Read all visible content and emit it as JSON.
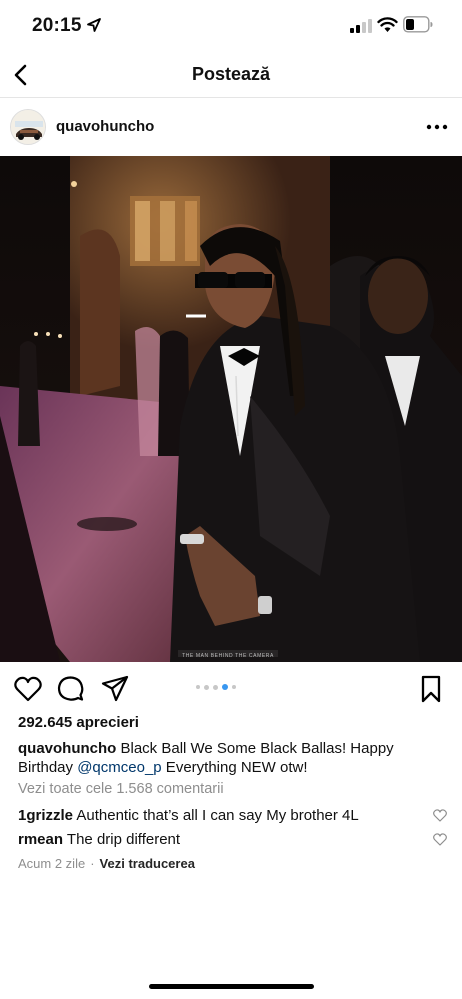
{
  "status_bar": {
    "time": "20:15",
    "icons": [
      "location-arrow-icon",
      "signal-icon",
      "wifi-icon",
      "battery-icon"
    ]
  },
  "nav": {
    "title": "Postează",
    "back_icon": "chevron-left-icon"
  },
  "post": {
    "username": "quavohuncho",
    "more_icon": "more-horizontal-icon",
    "image_watermark": "THE MAN BEHIND THE CAMERA",
    "carousel": {
      "count": 5,
      "active_index": 3
    },
    "likes": "292.645 aprecieri",
    "caption": {
      "user": "quavohuncho",
      "text_before": " Black Ball We Some Black Ballas! Happy Birthday ",
      "mention": "@qcmceo_p",
      "text_after": " Everything NEW otw!"
    },
    "view_comments": "Vezi toate cele 1.568 comentarii",
    "comments": [
      {
        "user": "1grizzle",
        "text": " Authentic that’s all I can say My brother 4L"
      },
      {
        "user": "rmean",
        "text": " The drip different"
      }
    ],
    "time_ago": "Acum 2 zile",
    "separator": "·",
    "translate": "Vezi traducerea"
  },
  "colors": {
    "accent": "#3897f0",
    "muted": "#8e8e8e",
    "mention": "#00376b",
    "text": "#111111"
  }
}
